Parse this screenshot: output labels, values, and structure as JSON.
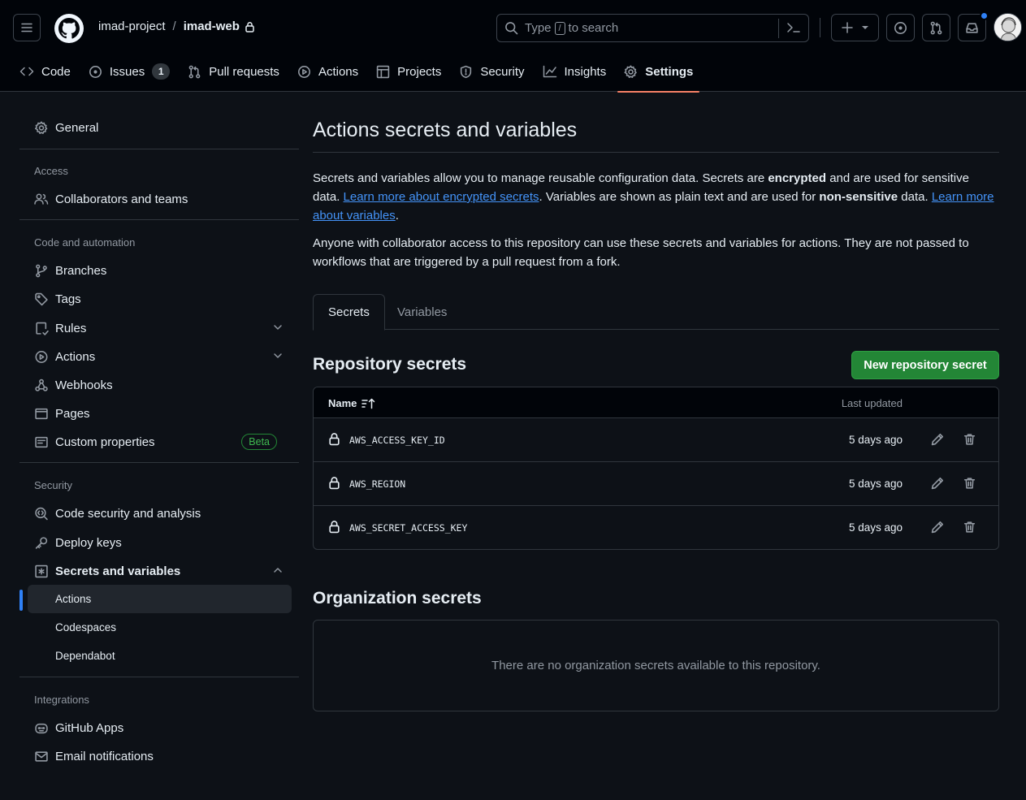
{
  "header": {
    "owner": "imad-project",
    "separator": "/",
    "repo": "imad-web",
    "search": {
      "before_key": "Type",
      "key": "/",
      "after_key": "to search"
    }
  },
  "repo_nav": [
    {
      "label": "Code",
      "icon": "code-icon"
    },
    {
      "label": "Issues",
      "icon": "issue-opened-icon",
      "count": "1"
    },
    {
      "label": "Pull requests",
      "icon": "git-pull-request-icon"
    },
    {
      "label": "Actions",
      "icon": "play-icon"
    },
    {
      "label": "Projects",
      "icon": "table-icon"
    },
    {
      "label": "Security",
      "icon": "shield-icon"
    },
    {
      "label": "Insights",
      "icon": "graph-icon"
    },
    {
      "label": "Settings",
      "icon": "gear-icon",
      "active": true
    }
  ],
  "sidebar": {
    "general": "General",
    "access_heading": "Access",
    "collaborators": "Collaborators and teams",
    "code_heading": "Code and automation",
    "branches": "Branches",
    "tags": "Tags",
    "rules": "Rules",
    "actions": "Actions",
    "webhooks": "Webhooks",
    "pages": "Pages",
    "custom_properties": "Custom properties",
    "beta_badge": "Beta",
    "security_heading": "Security",
    "code_security": "Code security and analysis",
    "deploy_keys": "Deploy keys",
    "secrets_variables": "Secrets and variables",
    "sub_actions": "Actions",
    "sub_codespaces": "Codespaces",
    "sub_dependabot": "Dependabot",
    "integrations_heading": "Integrations",
    "github_apps": "GitHub Apps",
    "email_notifications": "Email notifications"
  },
  "main": {
    "title": "Actions secrets and variables",
    "intro": {
      "t1": "Secrets and variables allow you to manage reusable configuration data. Secrets are ",
      "b1": "encrypted",
      "t2": " and are used for sensitive data. ",
      "link1": "Learn more about encrypted secrets",
      "t3": ". Variables are shown as plain text and are used for ",
      "b2": "non-sensitive",
      "t4": " data. ",
      "link2": "Learn more about variables",
      "t5": "."
    },
    "notice": "Anyone with collaborator access to this repository can use these secrets and variables for actions. They are not passed to workflows that are triggered by a pull request from a fork.",
    "tabs": {
      "secrets": "Secrets",
      "variables": "Variables"
    },
    "repo_secrets_title": "Repository secrets",
    "new_secret_button": "New repository secret",
    "table": {
      "col_name": "Name",
      "col_updated": "Last updated",
      "rows": [
        {
          "name": "AWS_ACCESS_KEY_ID",
          "updated": "5 days ago"
        },
        {
          "name": "AWS_REGION",
          "updated": "5 days ago"
        },
        {
          "name": "AWS_SECRET_ACCESS_KEY",
          "updated": "5 days ago"
        }
      ]
    },
    "org_secrets_title": "Organization secrets",
    "org_empty": "There are no organization secrets available to this repository."
  },
  "colors": {
    "background": "#0d1117",
    "header_bg": "#010409",
    "border": "#30363d",
    "link": "#4493f8",
    "primary_button": "#238636",
    "active_tab_underline": "#f78166",
    "selected_indicator": "#2f81f7"
  }
}
